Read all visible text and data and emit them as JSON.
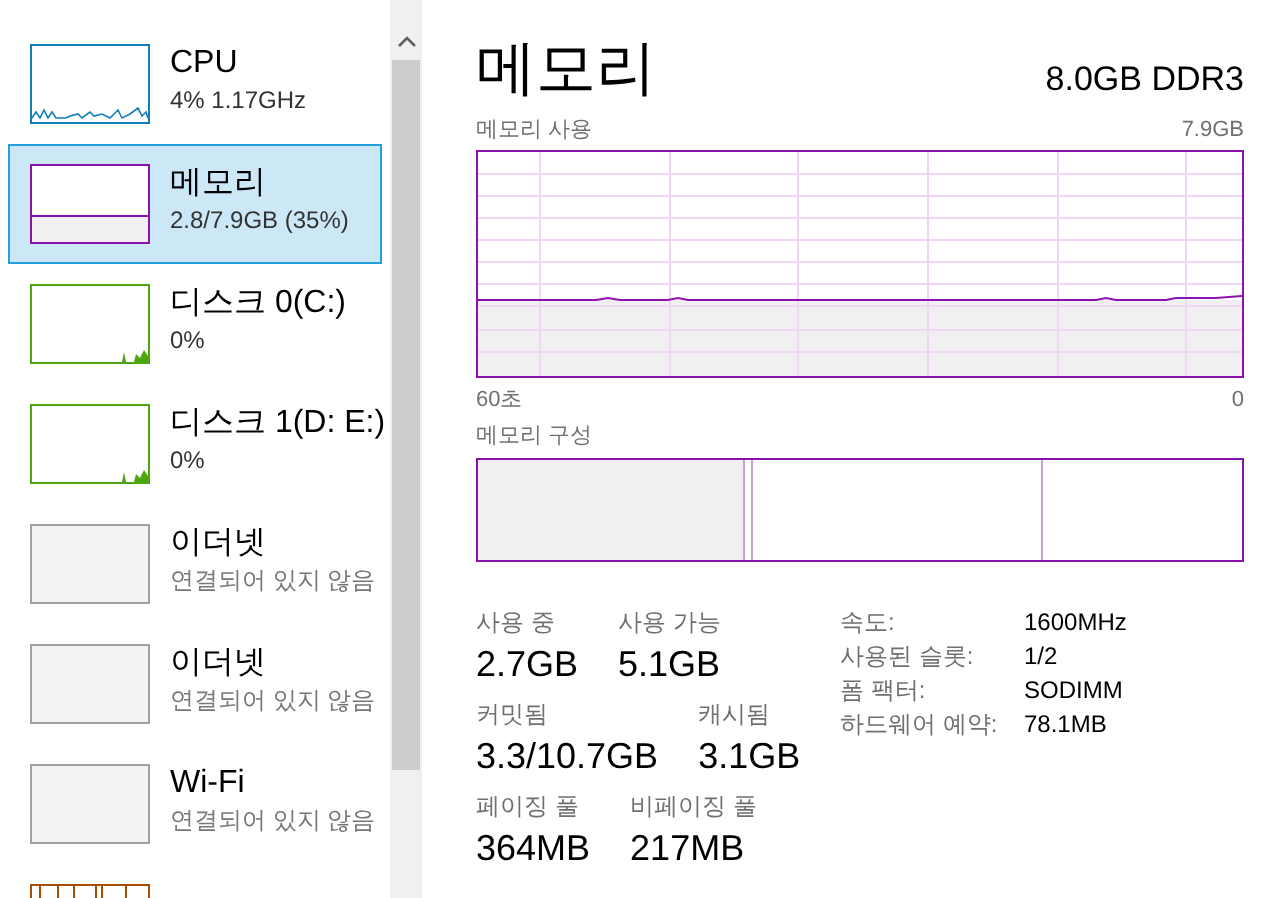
{
  "sidebar": {
    "items": [
      {
        "kind": "cpu",
        "name": "CPU",
        "detail": "4% 1.17GHz",
        "color": "#117dbb",
        "selected": false
      },
      {
        "kind": "memory",
        "name": "메모리",
        "detail": "2.8/7.9GB (35%)",
        "color": "#8b12ae",
        "selected": true
      },
      {
        "kind": "disk",
        "name": "디스크 0(C:)",
        "detail": "0%",
        "color": "#4da60c",
        "selected": false
      },
      {
        "kind": "disk",
        "name": "디스크 1(D: E:)",
        "detail": "0%",
        "color": "#4da60c",
        "selected": false
      },
      {
        "kind": "offline",
        "name": "이더넷",
        "detail": "연결되어 있지 않음",
        "color": "#a0a0a0",
        "selected": false
      },
      {
        "kind": "offline",
        "name": "이더넷",
        "detail": "연결되어 있지 않음",
        "color": "#a0a0a0",
        "selected": false
      },
      {
        "kind": "offline",
        "name": "Wi-Fi",
        "detail": "연결되어 있지 않음",
        "color": "#a0a0a0",
        "selected": false
      },
      {
        "kind": "network",
        "color": "#a74f01",
        "selected": false
      }
    ]
  },
  "detail": {
    "title": "메모리",
    "subtitle": "8.0GB DDR3",
    "usage_label": "메모리 사용",
    "usage_max": "7.9GB",
    "time_start": "60초",
    "time_end": "0",
    "composition_label": "메모리 구성",
    "stat_rows": [
      {
        "items": [
          {
            "label": "사용 중",
            "value": "2.7GB"
          },
          {
            "label": "사용 가능",
            "value": "5.1GB"
          }
        ]
      },
      {
        "items": [
          {
            "label": "커밋됨",
            "value": "3.3/10.7GB"
          },
          {
            "label": "캐시됨",
            "value": "3.1GB"
          }
        ]
      },
      {
        "items": [
          {
            "label": "페이징 풀",
            "value": "364MB"
          },
          {
            "label": "비페이징 풀",
            "value": "217MB"
          }
        ]
      }
    ],
    "properties": [
      {
        "label": "속도:",
        "value": "1600MHz"
      },
      {
        "label": "사용된 슬롯:",
        "value": "1/2"
      },
      {
        "label": "폼 팩터:",
        "value": "SODIMM"
      },
      {
        "label": "하드웨어 예약:",
        "value": "78.1MB"
      }
    ]
  }
}
